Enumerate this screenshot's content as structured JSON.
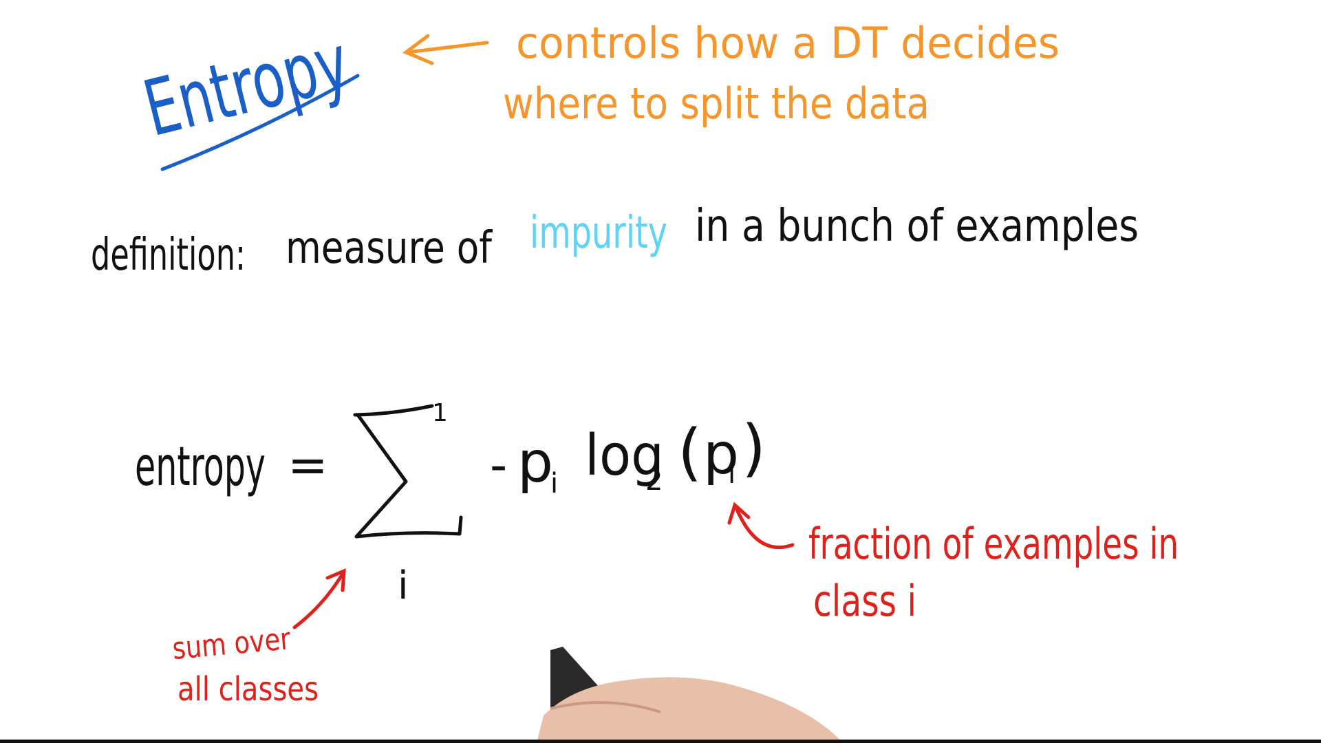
{
  "title": "Entropy",
  "note": {
    "line1": "controls how a DT decides",
    "line2": "where to split the data"
  },
  "definition": {
    "label": "definition:",
    "before": "measure of",
    "highlight": "impurity",
    "after": "in a bunch of examples"
  },
  "formula": {
    "lhs": "entropy",
    "equals": "=",
    "sigma": "∑",
    "upper": "1",
    "index": "i",
    "minus": "-",
    "p": "p",
    "sub_i": "i",
    "log": "log",
    "base": "2",
    "open_paren": "(",
    "close_paren": ")"
  },
  "annotations": {
    "fraction_line1": "fraction of examples in",
    "fraction_line2": "class i",
    "sum_line1": "sum over",
    "sum_line2": "all classes"
  },
  "colors": {
    "title": "#1a5fc8",
    "note": "#f5952a",
    "text": "#111111",
    "highlight": "#5fd3f5",
    "annotation": "#e0201a"
  }
}
